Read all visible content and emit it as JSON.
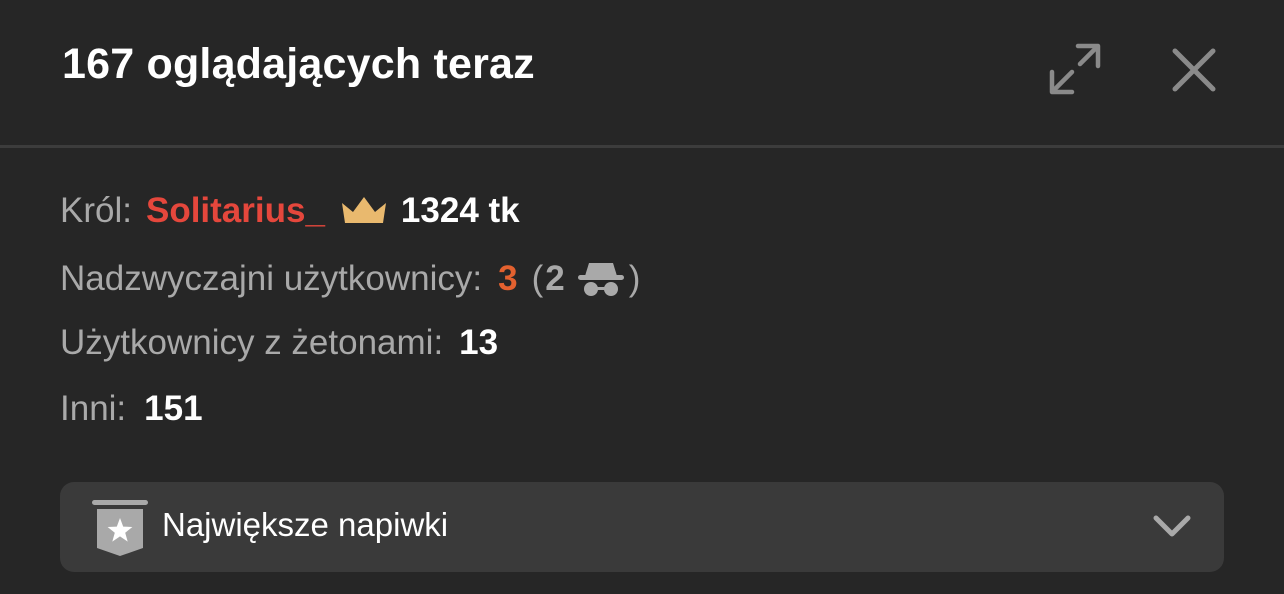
{
  "header": {
    "title": "167 oglądających teraz",
    "icons": {
      "expand": "expand-icon",
      "close": "close-icon"
    }
  },
  "stats": {
    "king": {
      "label": "Król:",
      "name": "Solitarius_",
      "icon": "crown-icon",
      "tokens": "1324 tk"
    },
    "special_users": {
      "label": "Nadzwyczajni użytkownicy:",
      "count": "3",
      "paren_open": "(",
      "anonymous_count": "2",
      "anonymous_icon": "incognito-icon",
      "paren_close": ")"
    },
    "token_users": {
      "label": "Użytkownicy z żetonami:",
      "count": "13"
    },
    "others": {
      "label": "Inni:",
      "count": "151"
    }
  },
  "top_tips": {
    "label": "Największe napiwki",
    "icon": "star-badge-icon",
    "chevron_icon": "chevron-down-icon"
  },
  "colors": {
    "background": "#262626",
    "king_name": "#e5473c",
    "crown": "#e9b96e",
    "special_count": "#e3612f",
    "muted_label": "#a9a9a9",
    "dropdown_bg": "#3a3a3a"
  }
}
